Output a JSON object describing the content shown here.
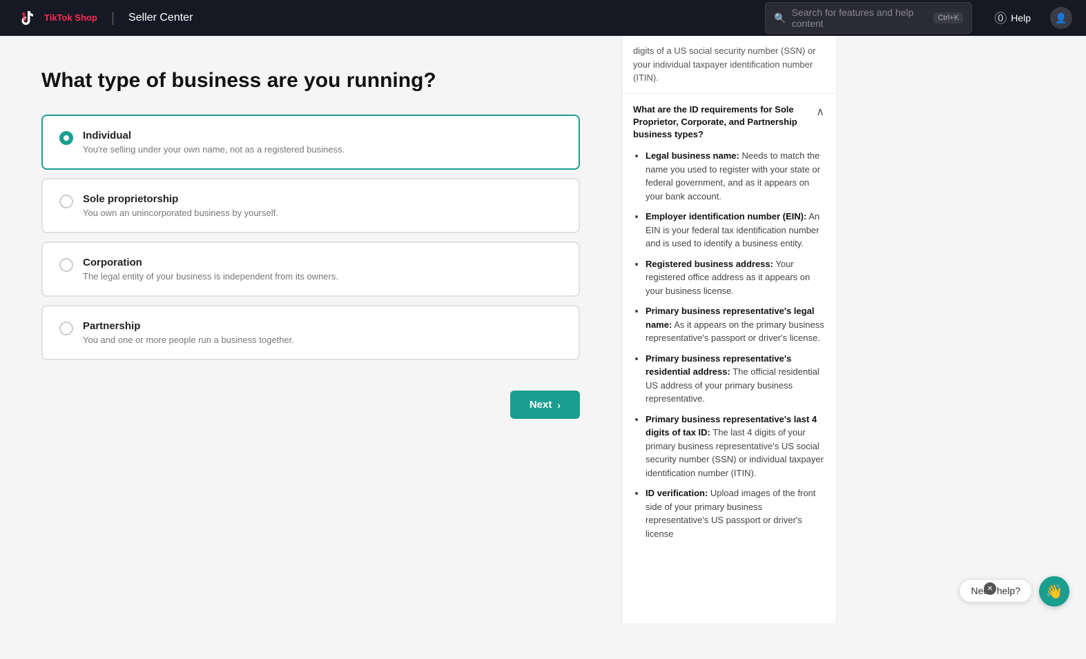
{
  "header": {
    "app_name": "TikTok Shop",
    "platform": "Seller Center",
    "search_placeholder": "Search for features and help content",
    "search_shortcut": "Ctrl+K",
    "help_label": "Help"
  },
  "page": {
    "title": "What type of business are you running?"
  },
  "business_types": [
    {
      "id": "individual",
      "title": "Individual",
      "description": "You're selling under your own name, not as a registered business.",
      "selected": true
    },
    {
      "id": "sole_proprietorship",
      "title": "Sole proprietorship",
      "description": "You own an unincorporated business by yourself.",
      "selected": false
    },
    {
      "id": "corporation",
      "title": "Corporation",
      "description": "The legal entity of your business is independent from its owners.",
      "selected": false
    },
    {
      "id": "partnership",
      "title": "Partnership",
      "description": "You and one or more people run a business together.",
      "selected": false
    }
  ],
  "next_button": "Next",
  "right_panel": {
    "faded_text": "digits of a US social security number (SSN) or your individual taxpayer identification number (ITIN).",
    "section_title": "What are the ID requirements for Sole Proprietor, Corporate, and Partnership business types?",
    "items": [
      {
        "label": "Legal business name:",
        "text": "Needs to match the name you used to register with your state or federal government, and as it appears on your bank account."
      },
      {
        "label": "Employer identification number (EIN):",
        "text": "An EIN is your federal tax identification number and is used to identify a business entity."
      },
      {
        "label": "Registered business address:",
        "text": "Your registered office address as it appears on your business license."
      },
      {
        "label": "Primary business representative's legal name:",
        "text": "As it appears on the primary business representative's passport or driver's license."
      },
      {
        "label": "Primary business representative's residential address:",
        "text": "The official residential US address of your primary business representative."
      },
      {
        "label": "Primary business representative's last 4 digits of tax ID:",
        "text": "The last 4 digits of your primary business representative's US social security number (SSN) or individual taxpayer identification number (ITIN)."
      },
      {
        "label": "ID verification:",
        "text": "Upload images of the front side of your primary business representative's US passport or driver's license"
      }
    ]
  },
  "chat": {
    "label": "Need help?"
  }
}
